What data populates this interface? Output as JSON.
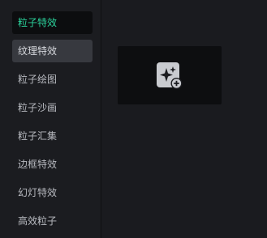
{
  "sidebar": {
    "items": [
      {
        "label": "粒子特效",
        "state": "selected"
      },
      {
        "label": "纹理特效",
        "state": "hover"
      },
      {
        "label": "粒子绘图",
        "state": "normal"
      },
      {
        "label": "粒子沙画",
        "state": "normal"
      },
      {
        "label": "粒子汇集",
        "state": "normal"
      },
      {
        "label": "边框特效",
        "state": "normal"
      },
      {
        "label": "幻灯特效",
        "state": "normal"
      },
      {
        "label": "高效粒子",
        "state": "normal"
      }
    ]
  },
  "content": {
    "add_card": {
      "icon": "sparkle-add-icon"
    }
  },
  "colors": {
    "accent": "#2bd39c",
    "background": "#1a1b1f",
    "selected_bg": "#0c0d0f",
    "hover_bg": "#37393f",
    "text": "#b8bac0"
  }
}
